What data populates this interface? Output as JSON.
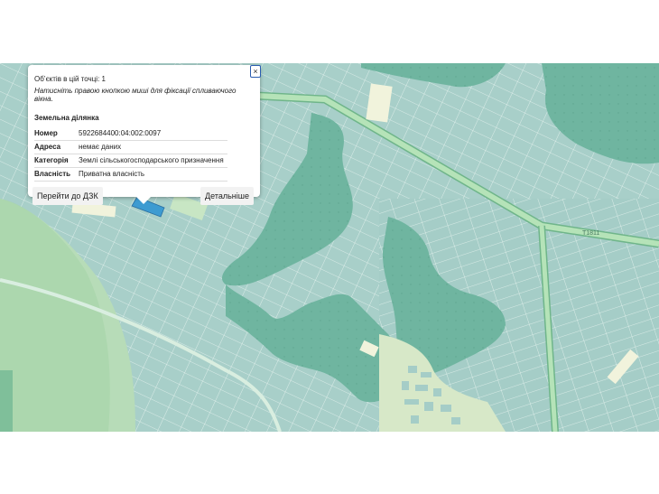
{
  "popup": {
    "count_text": "Об’єктів в цій точці: 1",
    "hint_text": "Натисніть правою кнопкою миші для фіксації спливаючого вікна.",
    "close_label": "×",
    "section_title": "Земельна ділянка",
    "rows": [
      {
        "key": "Номер",
        "value": "5922684400:04:002:0097"
      },
      {
        "key": "Адреса",
        "value": "немає даних"
      },
      {
        "key": "Категорія",
        "value": "Землі сільськогосподарського призначення"
      },
      {
        "key": "Власність",
        "value": "Приватна власність"
      }
    ],
    "btn_dzk": "Перейти до ДЗК",
    "btn_details": "Детальніше"
  },
  "map": {
    "road_label": "Т1811"
  },
  "colors": {
    "parcel": "#a8cfc9",
    "forest": "#6fb5a0",
    "meadow": "#c8e6c4",
    "road": "#9fd8a8",
    "selected": "#3d9bd1"
  }
}
